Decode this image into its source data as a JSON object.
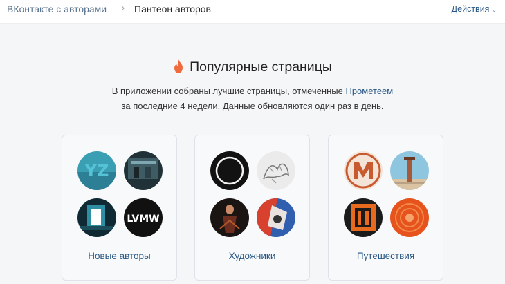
{
  "header": {
    "breadcrumb_root": "ВКонтакте с авторами",
    "breadcrumb_sep": "›",
    "breadcrumb_current": "Пантеон авторов",
    "actions_label": "Действия"
  },
  "main": {
    "title": "Популярные страницы",
    "desc_part1": "В приложении собраны лучшие страницы, отмеченные ",
    "desc_link": "Прометеем",
    "desc_part2": "за последние 4 недели. Данные обновляются один раз в день."
  },
  "categories": [
    {
      "label": "Новые авторы",
      "avatar_texts": [
        "YZ",
        "",
        "",
        "LVMW"
      ]
    },
    {
      "label": "Художники"
    },
    {
      "label": "Путешествия"
    }
  ],
  "colors": {
    "accent_link": "#2a5885",
    "flame": "#ef6b3d",
    "background": "#f5f6f8"
  },
  "icons": [
    "flame-icon",
    "chevron-down-icon"
  ]
}
